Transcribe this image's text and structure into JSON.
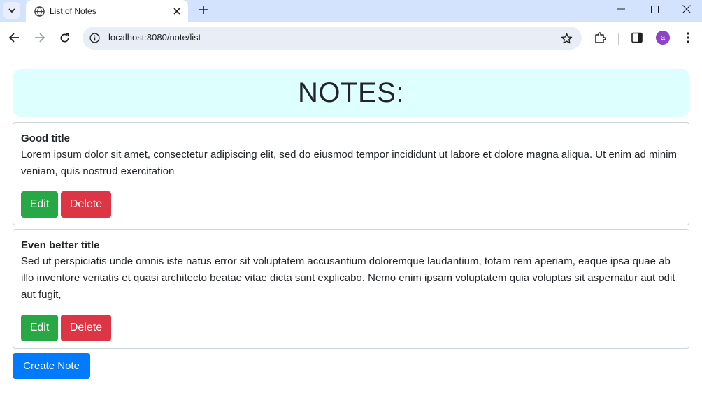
{
  "browser": {
    "tab_title": "List of Notes",
    "url": "localhost:8080/note/list",
    "avatar_letter": "a",
    "icons": [
      "tab-search-icon",
      "globe-icon",
      "close-icon",
      "plus-icon",
      "minimize-icon",
      "maximize-icon",
      "window-close-icon",
      "back-icon",
      "forward-icon",
      "reload-icon",
      "info-icon",
      "star-icon",
      "extensions-icon",
      "side-panel-icon",
      "more-icon"
    ]
  },
  "page": {
    "heading": "NOTES:",
    "notes": [
      {
        "title": "Good title",
        "body": "Lorem ipsum dolor sit amet, consectetur adipiscing elit, sed do eiusmod tempor incididunt ut labore et dolore magna aliqua. Ut enim ad minim veniam, quis nostrud exercitation",
        "edit_label": "Edit",
        "delete_label": "Delete"
      },
      {
        "title": "Even better title",
        "body": "Sed ut perspiciatis unde omnis iste natus error sit voluptatem accusantium doloremque laudantium, totam rem aperiam, eaque ipsa quae ab illo inventore veritatis et quasi architecto beatae vitae dicta sunt explicabo. Nemo enim ipsam voluptatem quia voluptas sit aspernatur aut odit aut fugit,",
        "edit_label": "Edit",
        "delete_label": "Delete"
      }
    ],
    "create_label": "Create Note"
  },
  "colors": {
    "header_bg": "#ddfffe",
    "edit": "#28a745",
    "delete": "#dc3545",
    "create": "#007bff"
  }
}
